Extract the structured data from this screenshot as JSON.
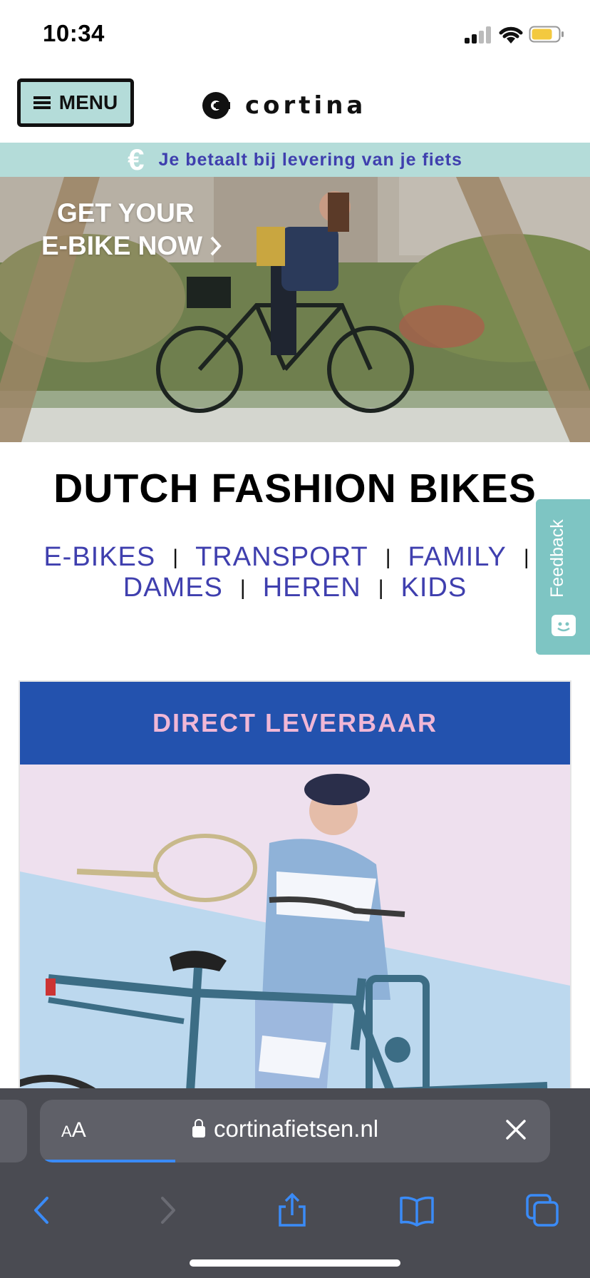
{
  "status_bar": {
    "time": "10:34",
    "icons": [
      "cellular-signal-icon",
      "wifi-icon",
      "battery-icon"
    ],
    "battery_color": "#f3c93f"
  },
  "header": {
    "menu_label": "MENU",
    "brand": "cortina"
  },
  "banner": {
    "icon": "euro-icon",
    "text": "Je betaalt bij levering van je fiets",
    "background": "#b4dcd9",
    "text_color": "#3f3fae"
  },
  "hero": {
    "cta_line1": "GET YOUR",
    "cta_line2": "E-BIKE NOW",
    "cta_icon": "chevron-right-icon"
  },
  "page_title": "DUTCH FASHION BIKES",
  "categories": {
    "row1": [
      "E-BIKES",
      "TRANSPORT",
      "FAMILY"
    ],
    "row2": [
      "DAMES",
      "HEREN",
      "KIDS"
    ],
    "separator": "|",
    "link_color": "#3f3fae"
  },
  "feedback": {
    "label": "Feedback",
    "icon": "chat-face-icon",
    "color": "#7ec5c3"
  },
  "product_card": {
    "title": "DIRECT LEVERBAAR",
    "header_color": "#2352ae",
    "title_color": "#f0b7d6"
  },
  "browser": {
    "text_size_label_small": "A",
    "text_size_label": "A",
    "url": "cortinafietsen.nl",
    "toolbar": [
      "back-icon",
      "forward-icon",
      "share-icon",
      "bookmarks-icon",
      "tabs-icon"
    ],
    "accent": "#3a8bf7"
  }
}
